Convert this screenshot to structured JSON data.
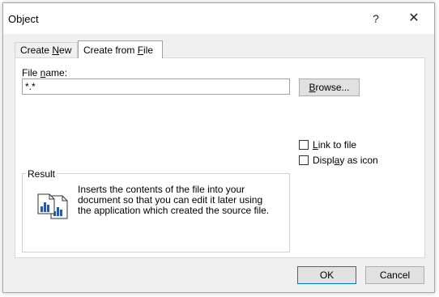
{
  "window": {
    "title": "Object",
    "help_label": "?",
    "close_label": "✕"
  },
  "tabs": [
    {
      "label_pre": "Create ",
      "label_u": "N",
      "label_post": "ew",
      "active": false
    },
    {
      "label_pre": "Create from ",
      "label_u": "F",
      "label_post": "ile",
      "active": true
    }
  ],
  "file": {
    "label_pre": "File ",
    "label_u": "n",
    "label_post": "ame:",
    "value": "*.*",
    "browse_pre": "",
    "browse_u": "B",
    "browse_post": "rowse..."
  },
  "options": {
    "link_pre": "",
    "link_u": "L",
    "link_post": "ink to file",
    "link_checked": false,
    "icon_pre": "Displ",
    "icon_u": "a",
    "icon_post": "y as icon",
    "icon_checked": false
  },
  "result": {
    "title": "Result",
    "text": "Inserts the contents of the file into your document so that you can edit it later using the application which created the source file.",
    "icon": "document-chart-icon"
  },
  "footer": {
    "ok_label": "OK",
    "cancel_label": "Cancel"
  }
}
